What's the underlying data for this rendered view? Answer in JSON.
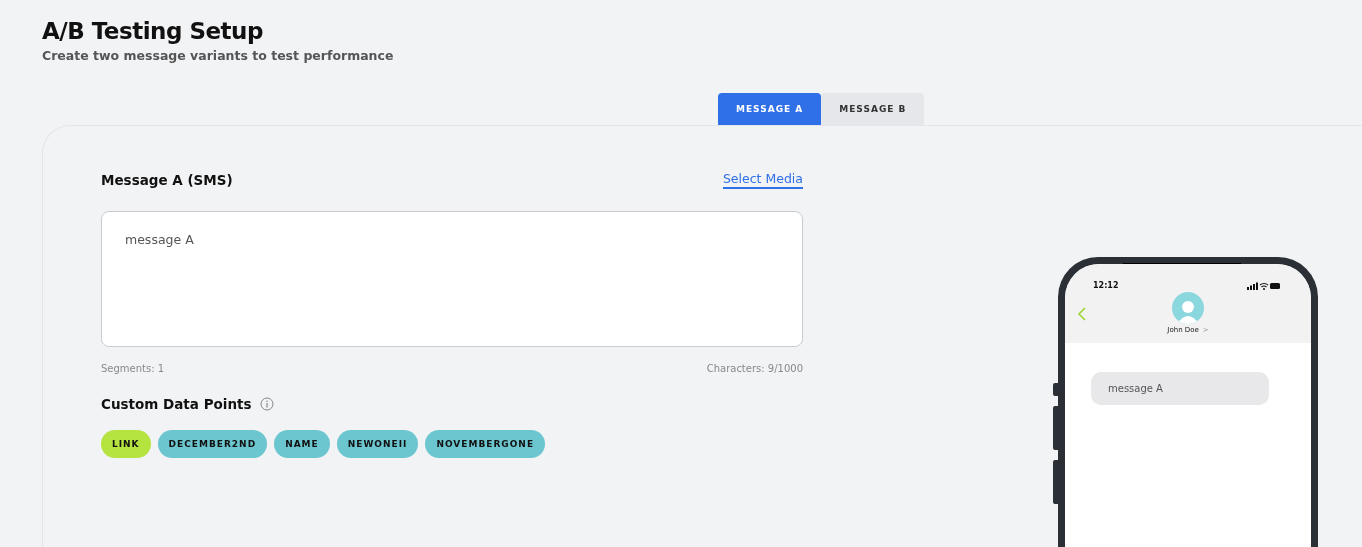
{
  "header": {
    "title": "A/B Testing Setup",
    "subtitle": "Create two message variants to test performance"
  },
  "tabs": [
    {
      "label": "MESSAGE A",
      "selected": true
    },
    {
      "label": "MESSAGE B",
      "selected": false
    }
  ],
  "editor": {
    "label": "Message A (SMS)",
    "media_link": "Select Media",
    "value": "message A",
    "segments": "Segments: 1",
    "characters": "Characters: 9/1000"
  },
  "custom_data_points": {
    "label": "Custom Data Points",
    "chips": [
      {
        "label": "LINK",
        "color": "#b5e33f"
      },
      {
        "label": "DECEMBER2ND",
        "color": "#6cc6cf"
      },
      {
        "label": "NAME",
        "color": "#6cc6cf"
      },
      {
        "label": "NEWONEII",
        "color": "#6cc6cf"
      },
      {
        "label": "NOVEMBERGONE",
        "color": "#6cc6cf"
      }
    ]
  },
  "phone_preview": {
    "time": "12:12",
    "contact": "John Doe",
    "contact_chevron": ">",
    "message": "message A"
  }
}
